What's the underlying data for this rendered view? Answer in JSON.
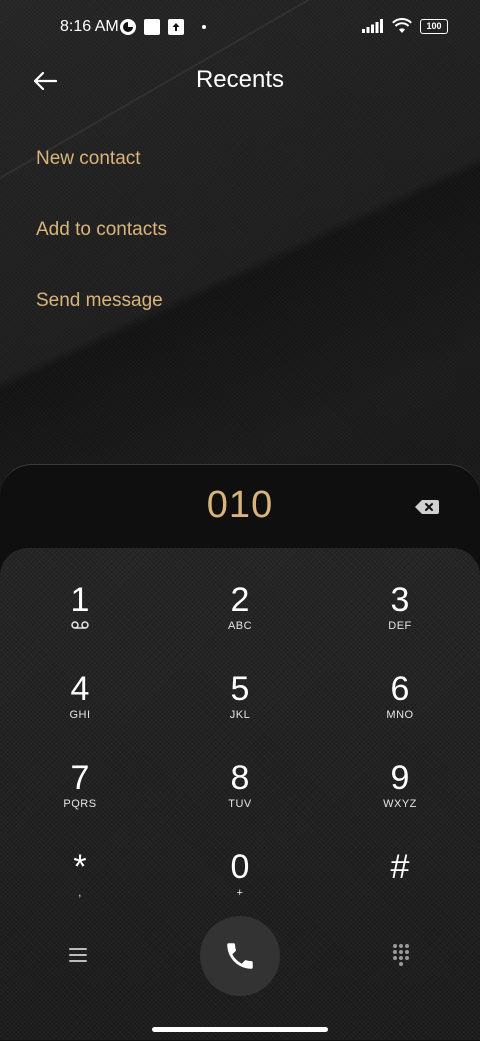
{
  "status": {
    "time": "8:16 AM",
    "battery": "100"
  },
  "header": {
    "title": "Recents"
  },
  "menu": {
    "new_contact": "New contact",
    "add_to_contacts": "Add to contacts",
    "send_message": "Send message"
  },
  "dialer": {
    "number": "010",
    "keys": [
      {
        "digit": "1",
        "letters": ""
      },
      {
        "digit": "2",
        "letters": "ABC"
      },
      {
        "digit": "3",
        "letters": "DEF"
      },
      {
        "digit": "4",
        "letters": "GHI"
      },
      {
        "digit": "5",
        "letters": "JKL"
      },
      {
        "digit": "6",
        "letters": "MNO"
      },
      {
        "digit": "7",
        "letters": "PQRS"
      },
      {
        "digit": "8",
        "letters": "TUV"
      },
      {
        "digit": "9",
        "letters": "WXYZ"
      },
      {
        "digit": "*",
        "letters": ","
      },
      {
        "digit": "0",
        "letters": "+"
      },
      {
        "digit": "#",
        "letters": ""
      }
    ]
  },
  "colors": {
    "accent": "#d9b57b",
    "background": "#1a1a1a",
    "call_button": "#333333"
  },
  "icons": {
    "back": "arrow-left-icon",
    "backspace": "backspace-icon",
    "voicemail": "voicemail-icon",
    "menu": "hamburger-menu-icon",
    "call": "phone-icon",
    "dialpad": "dialpad-icon"
  }
}
